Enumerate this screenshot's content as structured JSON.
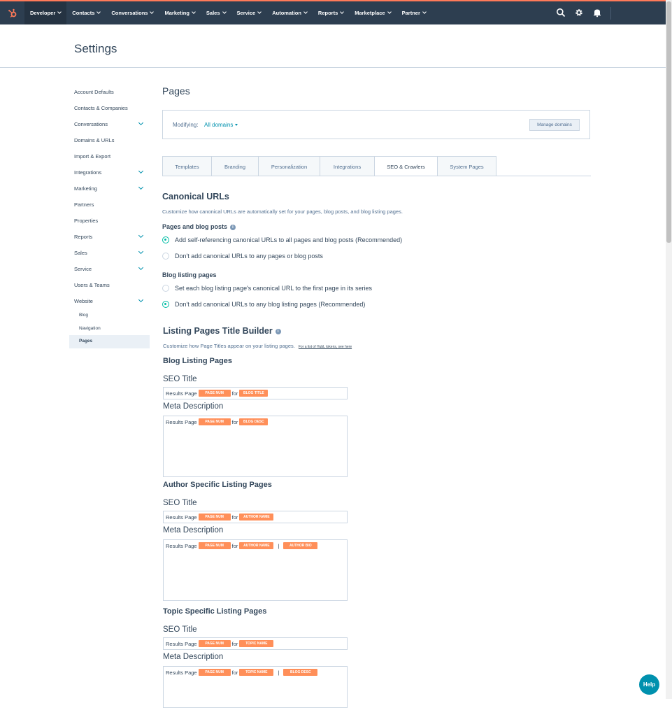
{
  "nav": {
    "items": [
      "Developer",
      "Contacts",
      "Conversations",
      "Marketing",
      "Sales",
      "Service",
      "Automation",
      "Reports",
      "Marketplace",
      "Partner"
    ]
  },
  "settings": {
    "title": "Settings"
  },
  "sidebar": {
    "items": [
      {
        "label": "Account Defaults",
        "expandable": false
      },
      {
        "label": "Contacts & Companies",
        "expandable": false
      },
      {
        "label": "Conversations",
        "expandable": true
      },
      {
        "label": "Domains & URLs",
        "expandable": false
      },
      {
        "label": "Import & Export",
        "expandable": false
      },
      {
        "label": "Integrations",
        "expandable": true
      },
      {
        "label": "Marketing",
        "expandable": true
      },
      {
        "label": "Partners",
        "expandable": false
      },
      {
        "label": "Properties",
        "expandable": false
      },
      {
        "label": "Reports",
        "expandable": true
      },
      {
        "label": "Sales",
        "expandable": true
      },
      {
        "label": "Service",
        "expandable": true
      },
      {
        "label": "Users & Teams",
        "expandable": false
      },
      {
        "label": "Website",
        "expandable": true
      }
    ],
    "website_sub": [
      "Blog",
      "Navigation",
      "Pages"
    ],
    "active_sub": "Pages"
  },
  "main": {
    "title": "Pages",
    "modifying_label": "Modifying:",
    "domain_select": "All domains",
    "manage_button": "Manage domains",
    "tabs": [
      "Templates",
      "Branding",
      "Personalization",
      "Integrations",
      "SEO & Crawlers",
      "System Pages"
    ],
    "active_tab": "SEO & Crawlers"
  },
  "canonical": {
    "title": "Canonical URLs",
    "description": "Customize how canonical URLs are automatically set for your pages, blog posts, and blog listing pages.",
    "pages_heading": "Pages and blog posts",
    "pages_option_1": "Add self-referencing canonical URLs to all pages and blog posts (Recommended)",
    "pages_option_2": "Don't add canonical URLs to any pages or blog posts",
    "listing_heading": "Blog listing pages",
    "listing_option_1": "Set each blog listing page's canonical URL to the first page in its series",
    "listing_option_2": "Don't add canonical URLs to any blog listing pages (Recommended)"
  },
  "builder": {
    "title": "Listing Pages Title Builder",
    "description": "Customize how Page Titles appear on your listing pages.",
    "link": "For a list of HubL tokens, see here",
    "seo_title_label": "SEO Title",
    "meta_desc_label": "Meta Description",
    "results_page": "Results Page",
    "for": "for",
    "pipe": "|",
    "blog": {
      "heading": "Blog Listing Pages",
      "title_tokens": [
        "PAGE NUM",
        "BLOG TITLE"
      ],
      "desc_tokens": [
        "PAGE NUM",
        "BLOG DESC"
      ]
    },
    "author": {
      "heading": "Author Specific Listing Pages",
      "title_tokens": [
        "PAGE NUM",
        "AUTHOR NAME"
      ],
      "desc_tokens": [
        "PAGE NUM",
        "AUTHOR NAME",
        "AUTHOR BIO"
      ]
    },
    "topic": {
      "heading": "Topic Specific Listing Pages",
      "title_tokens": [
        "PAGE NUM",
        "TOPIC NAME"
      ],
      "desc_tokens": [
        "PAGE NUM",
        "TOPIC NAME",
        "BLOG DESC"
      ]
    }
  },
  "help": {
    "label": "Help"
  },
  "colors": {
    "topbar": "#2d3e50",
    "accent": "#ff7a59",
    "token": "#ff8f59",
    "radio": "#00bda5",
    "link": "#0091ae"
  }
}
